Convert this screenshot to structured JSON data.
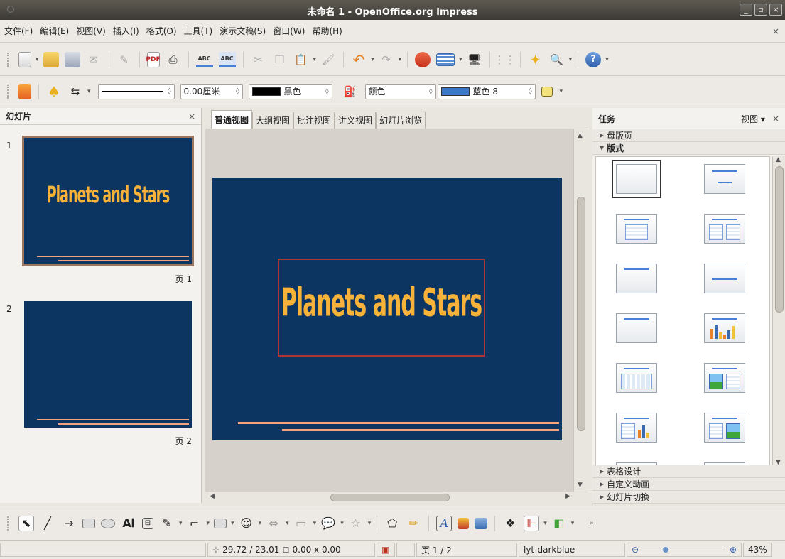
{
  "window": {
    "title": "未命名 1 - OpenOffice.org Impress"
  },
  "menu": {
    "items": [
      "文件(F)",
      "编辑(E)",
      "视图(V)",
      "插入(I)",
      "格式(O)",
      "工具(T)",
      "演示文稿(S)",
      "窗口(W)",
      "帮助(H)"
    ],
    "close": "×"
  },
  "line_toolbar": {
    "line_width": "0.00厘米",
    "line_color": "黑色",
    "fill_type": "颜色",
    "fill_color": "蓝色 8",
    "colors": {
      "line_swatch": "#000000",
      "fill_swatch": "#3f78c8"
    }
  },
  "slides_panel": {
    "title": "幻灯片",
    "slides": [
      {
        "number": "1",
        "wordart": "Planets and Stars",
        "page_label": "页 1"
      },
      {
        "number": "2",
        "wordart": "",
        "page_label": "页 2"
      }
    ]
  },
  "view_tabs": [
    "普通视图",
    "大纲视图",
    "批注视图",
    "讲义视图",
    "幻灯片浏览"
  ],
  "slide": {
    "title": "Planets and Stars",
    "background": "#0d3561",
    "accent": "#f4a27d",
    "title_color": "#f7b23a"
  },
  "task_panel": {
    "title": "任务",
    "view_label": "视图",
    "sections_top": [
      "母版页",
      "版式"
    ],
    "sections_bottom": [
      "表格设计",
      "自定义动画",
      "幻灯片切换"
    ]
  },
  "status": {
    "position": "29.72 / 23.01",
    "size": "0.00 x 0.00",
    "page": "页 1 / 2",
    "master": "lyt-darkblue",
    "zoom": "43%"
  }
}
